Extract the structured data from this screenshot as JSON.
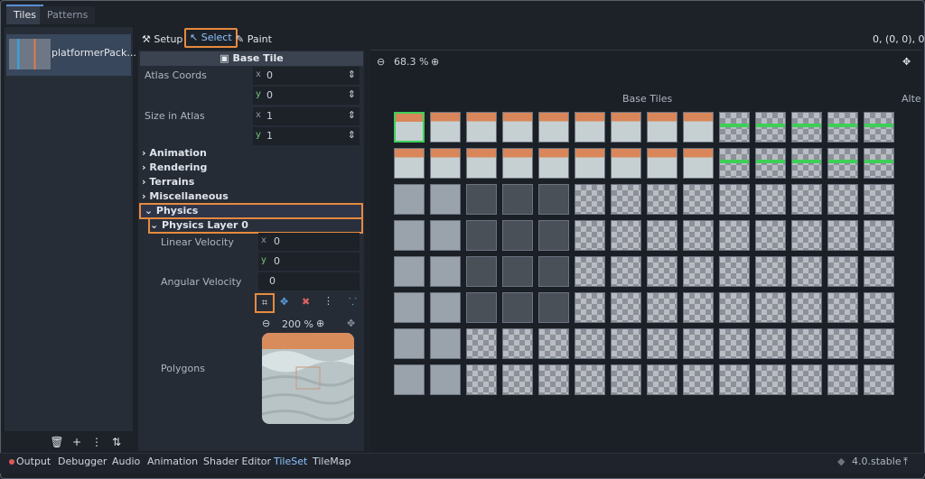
{
  "top_tabs": {
    "tiles": "Tiles",
    "patterns": "Patterns"
  },
  "sidebar": {
    "tileset_name": "platformerPack..."
  },
  "toolbar": {
    "setup": "Setup",
    "select": "Select",
    "paint": "Paint",
    "coords": "0, (0, 0), 0"
  },
  "inspector": {
    "header": "Base Tile",
    "atlas_coords": {
      "label": "Atlas Coords",
      "x": "0",
      "y": "0"
    },
    "size_in_atlas": {
      "label": "Size in Atlas",
      "x": "1",
      "y": "1"
    },
    "sections": [
      "Animation",
      "Rendering",
      "Terrains",
      "Miscellaneous"
    ],
    "physics": "Physics",
    "physics_layer": "Physics Layer 0",
    "linear_velocity": {
      "label": "Linear Velocity",
      "x": "0",
      "y": "0"
    },
    "angular_velocity": {
      "label": "Angular Velocity",
      "value": "0"
    },
    "polygon_zoom": "200 %",
    "polygons_label": "Polygons",
    "axis_x": "x",
    "axis_y": "y"
  },
  "atlas": {
    "zoom": "68.3 %",
    "base_tiles": "Base Tiles",
    "alt_tiles": "Alte"
  },
  "statusbar": {
    "tabs": [
      "Output",
      "Debugger",
      "Audio",
      "Animation",
      "Shader Editor",
      "TileSet",
      "TileMap"
    ],
    "active_tab": "TileSet",
    "version": "4.0.stable"
  },
  "colors": {
    "accent": "#e88a3e",
    "selection": "#8ec4ff",
    "tile_orange": "#d9875a",
    "tile_green": "#3ecf58"
  }
}
